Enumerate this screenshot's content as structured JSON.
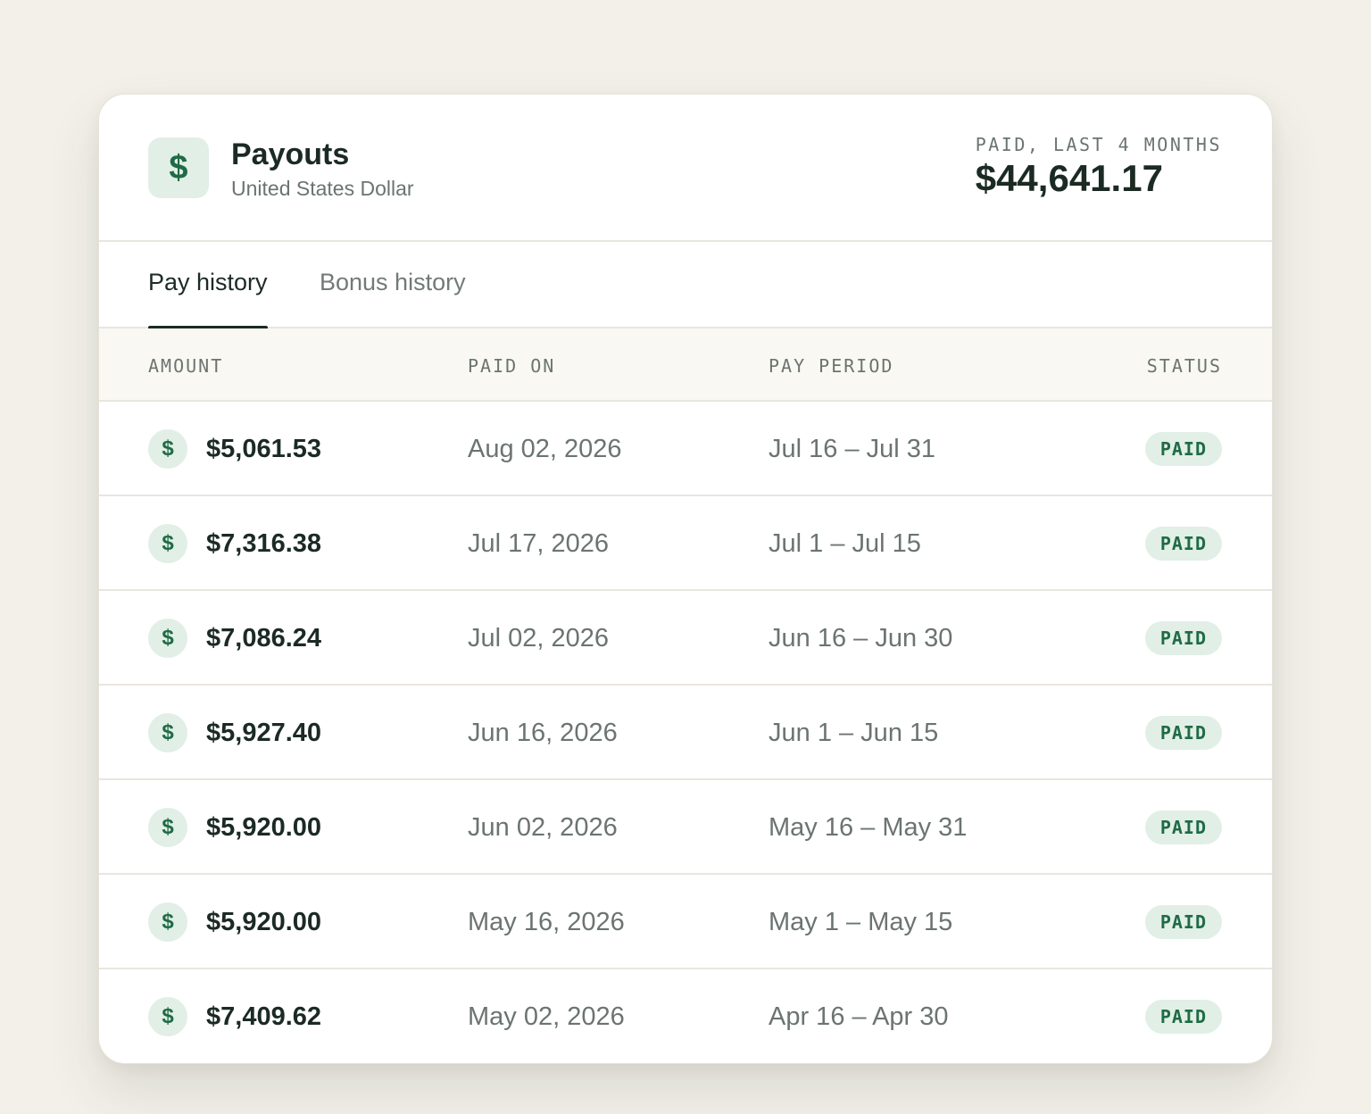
{
  "header": {
    "icon": "dollar-icon",
    "title": "Payouts",
    "subtitle": "United States Dollar",
    "summary_label": "PAID, LAST 4 MONTHS",
    "summary_value": "$44,641.17"
  },
  "tabs": [
    {
      "label": "Pay history",
      "active": true
    },
    {
      "label": "Bonus history",
      "active": false
    }
  ],
  "columns": {
    "amount": "AMOUNT",
    "paid_on": "PAID ON",
    "pay_period": "PAY PERIOD",
    "status": "STATUS"
  },
  "rows": [
    {
      "amount": "$5,061.53",
      "paid_on": "Aug 02, 2026",
      "pay_period": "Jul 16 – Jul 31",
      "status": "PAID"
    },
    {
      "amount": "$7,316.38",
      "paid_on": "Jul 17, 2026",
      "pay_period": "Jul 1 – Jul 15",
      "status": "PAID"
    },
    {
      "amount": "$7,086.24",
      "paid_on": "Jul 02, 2026",
      "pay_period": "Jun 16 – Jun 30",
      "status": "PAID"
    },
    {
      "amount": "$5,927.40",
      "paid_on": "Jun 16, 2026",
      "pay_period": "Jun 1 – Jun 15",
      "status": "PAID"
    },
    {
      "amount": "$5,920.00",
      "paid_on": "Jun 02, 2026",
      "pay_period": "May 16 – May 31",
      "status": "PAID"
    },
    {
      "amount": "$5,920.00",
      "paid_on": "May 16, 2026",
      "pay_period": "May 1 – May 15",
      "status": "PAID"
    },
    {
      "amount": "$7,409.62",
      "paid_on": "May 02, 2026",
      "pay_period": "Apr 16 – Apr 30",
      "status": "PAID"
    }
  ],
  "colors": {
    "accent": "#1f6b45",
    "accent_bg": "#e1efe6",
    "text": "#1c2a24",
    "muted": "#6b7470",
    "page_bg": "#f2f0e9"
  }
}
